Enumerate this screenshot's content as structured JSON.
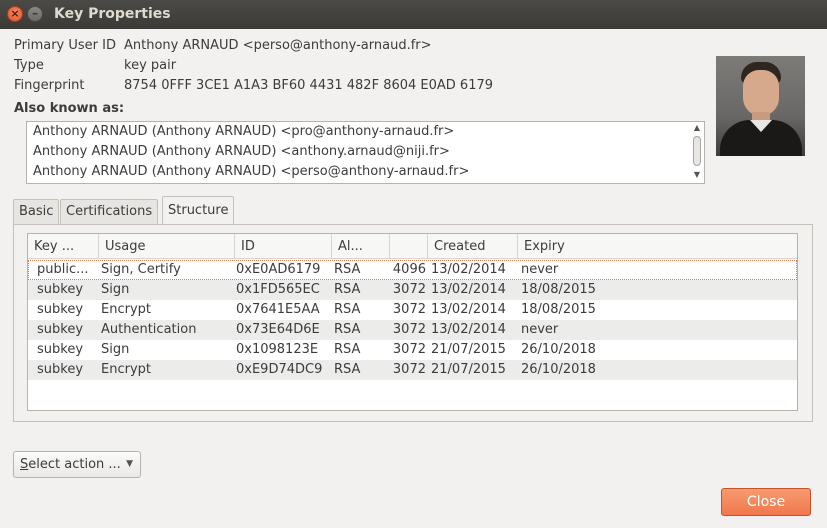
{
  "window": {
    "title": "Key Properties",
    "close_glyph": "×",
    "minimize_glyph": "–"
  },
  "properties": {
    "primary_user_id_label": "Primary User ID",
    "primary_user_id": "Anthony ARNAUD <perso@anthony-arnaud.fr>",
    "type_label": "Type",
    "type": "key pair",
    "fingerprint_label": "Fingerprint",
    "fingerprint": "8754 0FFF 3CE1 A1A3 BF60 4431 482F 8604 E0AD 6179"
  },
  "also_known_as": {
    "label": "Also known as:",
    "items": [
      "Anthony ARNAUD (Anthony ARNAUD) <pro@anthony-arnaud.fr>",
      "Anthony ARNAUD (Anthony ARNAUD) <anthony.arnaud@niji.fr>",
      "Anthony ARNAUD (Anthony ARNAUD) <perso@anthony-arnaud.fr>"
    ]
  },
  "tabs": [
    {
      "label": "Basic"
    },
    {
      "label": "Certifications"
    },
    {
      "label": "Structure",
      "active": true
    }
  ],
  "structure": {
    "columns": [
      "Key ...",
      "Usage",
      "ID",
      "Al...",
      "",
      "Created",
      "Expiry"
    ],
    "rows": [
      {
        "key": "public...",
        "usage": "Sign, Certify",
        "id": "0xE0AD6179",
        "algo": "RSA",
        "size": "4096",
        "created": "13/02/2014",
        "expiry": "never"
      },
      {
        "key": "subkey",
        "usage": "Sign",
        "id": "0x1FD565EC",
        "algo": "RSA",
        "size": "3072",
        "created": "13/02/2014",
        "expiry": "18/08/2015"
      },
      {
        "key": "subkey",
        "usage": "Encrypt",
        "id": "0x7641E5AA",
        "algo": "RSA",
        "size": "3072",
        "created": "13/02/2014",
        "expiry": "18/08/2015"
      },
      {
        "key": "subkey",
        "usage": "Authentication",
        "id": "0x73E64D6E",
        "algo": "RSA",
        "size": "3072",
        "created": "13/02/2014",
        "expiry": "never"
      },
      {
        "key": "subkey",
        "usage": "Sign",
        "id": "0x1098123E",
        "algo": "RSA",
        "size": "3072",
        "created": "21/07/2015",
        "expiry": "26/10/2018"
      },
      {
        "key": "subkey",
        "usage": "Encrypt",
        "id": "0xE9D74DC9",
        "algo": "RSA",
        "size": "3072",
        "created": "21/07/2015",
        "expiry": "26/10/2018"
      }
    ]
  },
  "select_action": {
    "label_mnemonic": "S",
    "label_rest": "elect action ...",
    "arrow": "▼"
  },
  "close_button": {
    "label": "Close"
  },
  "colors": {
    "accent": "#f0784a",
    "titlebar": "#3b3a36"
  }
}
